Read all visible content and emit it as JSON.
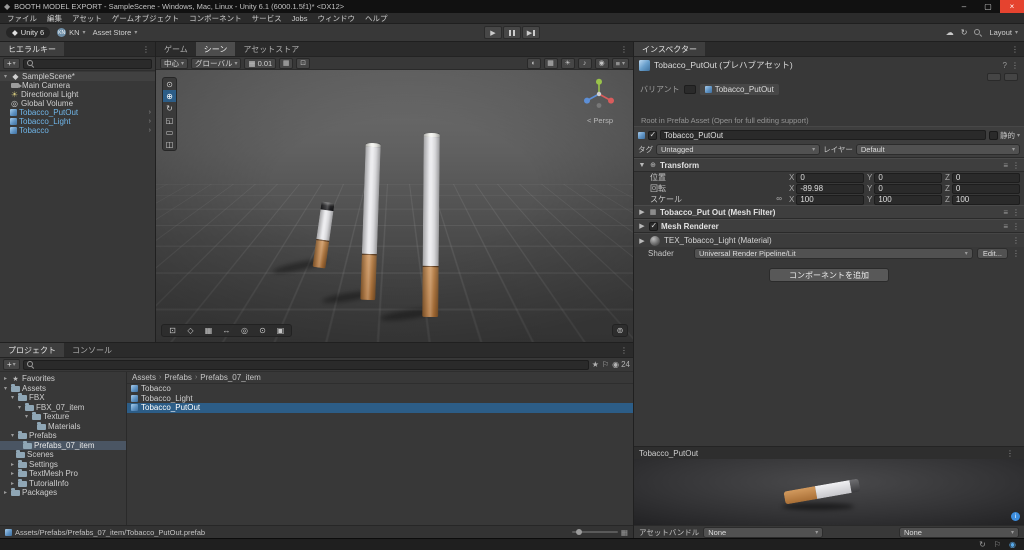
{
  "window": {
    "title": "BOOTH MODEL EXPORT - SampleScene - Windows, Mac, Linux - Unity 6.1 (6000.1.5f1)* <DX12>"
  },
  "menubar": [
    "ファイル",
    "編集",
    "アセット",
    "ゲームオブジェクト",
    "コンポーネント",
    "サービス",
    "Jobs",
    "ウィンドウ",
    "ヘルプ"
  ],
  "toolbar": {
    "unity_version": "Unity 6",
    "account": "KN",
    "account_initials": "KN",
    "asset_store": "Asset Store",
    "layout": "Layout"
  },
  "hierarchy": {
    "tab": "ヒエラルキー",
    "scene": "SampleScene*",
    "items": [
      {
        "name": "Main Camera"
      },
      {
        "name": "Directional Light"
      },
      {
        "name": "Global Volume"
      },
      {
        "name": "Tobacco_PutOut"
      },
      {
        "name": "Tobacco_Light"
      },
      {
        "name": "Tobacco"
      }
    ]
  },
  "scene_view": {
    "tabs": [
      "ゲーム",
      "シーン",
      "アセットストア"
    ],
    "active_tab": "シーン",
    "pivot": "中心",
    "orientation": "グローバル",
    "grid_size": "0.01",
    "persp_label": "< Persp"
  },
  "inspector": {
    "tab": "インスペクター",
    "title": "Tobacco_PutOut (プレハブアセット)",
    "variant_label": "バリアント",
    "breadcrumb_root": "Tobacco_PutOut",
    "root_note": "Root in Prefab Asset (Open for full editing support)",
    "go_name": "Tobacco_PutOut",
    "static_label": "静的",
    "tag_label": "タグ",
    "tag_value": "Untagged",
    "layer_label": "レイヤー",
    "layer_value": "Default",
    "axes": [
      "X",
      "Y",
      "Z"
    ],
    "transform": {
      "title": "Transform",
      "position_label": "位置",
      "rotation_label": "回転",
      "scale_label": "スケール",
      "position": {
        "x": "0",
        "y": "0",
        "z": "0"
      },
      "rotation": {
        "x": "-89.98",
        "y": "0",
        "z": "0"
      },
      "scale": {
        "x": "100",
        "y": "100",
        "z": "100"
      }
    },
    "mesh_filter_title": "Tobacco_Put Out (Mesh Filter)",
    "mesh_renderer_title": "Mesh Renderer",
    "material_title": "TEX_Tobacco_Light (Material)",
    "shader_label": "Shader",
    "shader_value": "Universal Render Pipeline/Lit",
    "edit_button": "Edit...",
    "add_component": "コンポーネントを追加",
    "preview_title": "Tobacco_PutOut",
    "assetbundle_label": "アセットバンドル",
    "assetbundle_value": "None",
    "assetbundle_variant": "None"
  },
  "project": {
    "tabs": [
      "プロジェクト",
      "コンソール"
    ],
    "active_tab": "プロジェクト",
    "hidden_count": "24",
    "favorites_label": "Favorites",
    "tree": [
      {
        "name": "Assets"
      },
      {
        "name": "FBX"
      },
      {
        "name": "FBX_07_item"
      },
      {
        "name": "Texture"
      },
      {
        "name": "Materials"
      },
      {
        "name": "Prefabs"
      },
      {
        "name": "Prefabs_07_item"
      },
      {
        "name": "Scenes"
      },
      {
        "name": "Settings"
      },
      {
        "name": "TextMesh Pro"
      },
      {
        "name": "TutorialInfo"
      },
      {
        "name": "Packages"
      }
    ],
    "breadcrumb": [
      "Assets",
      "Prefabs",
      "Prefabs_07_item"
    ],
    "files": [
      {
        "name": "Tobacco"
      },
      {
        "name": "Tobacco_Light"
      },
      {
        "name": "Tobacco_PutOut"
      }
    ],
    "status_path": "Assets/Prefabs/Prefabs_07_item/Tobacco_PutOut.prefab"
  },
  "glyphs": {
    "unity_logo": "◆",
    "minimize": "–",
    "maximize": "▢",
    "close": "×",
    "chevron_down": "▾",
    "chevron_right": "›",
    "expander_open": "▼",
    "expander_closed": "▶",
    "tree_open": "▾",
    "tree_closed": "▸",
    "kebab": "⋮",
    "plus": "+",
    "play": "▶",
    "cloud": "☁",
    "history": "↻",
    "star": "★",
    "flag": "⚐",
    "eye": "◉",
    "light": "☀",
    "volume": "◎",
    "sphere": "◐",
    "grid": "▦",
    "audio": "♪",
    "menu": "≡",
    "help": "?",
    "presets": "≡",
    "link": "∞",
    "scene_asset": "◆",
    "tool_view": "⊙",
    "tool_move": "⊕",
    "tool_rotate": "↻",
    "tool_scale": "◱",
    "tool_rect": "▭",
    "tool_transform": "◫",
    "vp1": "⊡",
    "vp2": "◇",
    "vp3": "▦",
    "vp4": "↔",
    "vp5": "◎",
    "vp6": "⊙",
    "vp7": "▣",
    "camera_overlay": "⊚",
    "snap1": "▦",
    "snap2": "⊡",
    "badge_info": "i"
  },
  "colors": {
    "selection_blue": "#2c5d87",
    "prefab_text_blue": "#6fb5e8",
    "close_red": "#e5432f",
    "filter_orange": "#b5793f"
  }
}
